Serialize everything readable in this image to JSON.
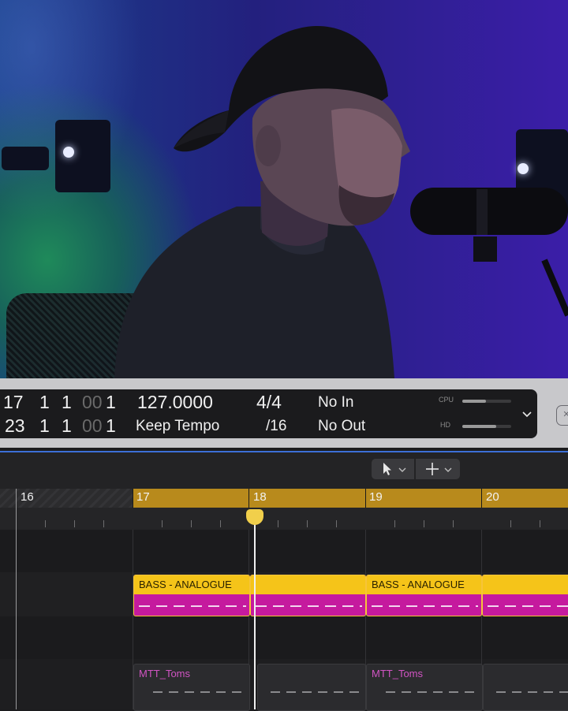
{
  "video": {
    "icons": [
      "speaker-icon",
      "microphone-icon"
    ]
  },
  "lcd": {
    "position_row1": {
      "bar": "17",
      "beat": "1",
      "div": "1",
      "tick_dim": "00",
      "tick": "1"
    },
    "position_row2": {
      "bar": "23",
      "beat": "1",
      "div": "1",
      "tick_dim": "00",
      "tick": "1"
    },
    "tempo": "127.0000",
    "tempo_mode": "Keep Tempo",
    "signature": "4/4",
    "division": "/16",
    "midi_in": "No In",
    "midi_out": "No Out",
    "cpu_label": "CPU",
    "hd_label": "HD",
    "cpu_level": 0.48,
    "hd_level": 0.7
  },
  "tools": {
    "pointer_icon": "pointer-arrow-icon",
    "crosshair_icon": "crosshair-icon",
    "chevron": "⌄"
  },
  "ruler": {
    "bars": [
      "16",
      "17",
      "18",
      "19",
      "20"
    ]
  },
  "regions": {
    "bass": [
      {
        "name": "BASS - ANALOGUE"
      },
      {
        "name": ""
      },
      {
        "name": "BASS - ANALOGUE"
      },
      {
        "name": ""
      }
    ],
    "toms": [
      {
        "name": "MTT_Toms"
      },
      {
        "name": ""
      },
      {
        "name": "MTT_Toms"
      },
      {
        "name": ""
      }
    ]
  },
  "colors": {
    "cycle": "#b88a1c",
    "bass_region": "#c51a9e",
    "region_header": "#f5c419",
    "toms_label": "#d154c3",
    "playhead": "#f1cf4b"
  }
}
